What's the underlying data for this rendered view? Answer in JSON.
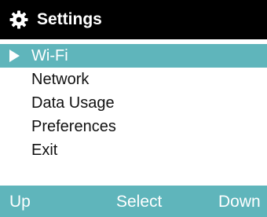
{
  "header": {
    "title": "Settings",
    "icon": "gear-icon"
  },
  "menu": {
    "selected_index": 0,
    "items": [
      {
        "label": "Wi-Fi"
      },
      {
        "label": "Network"
      },
      {
        "label": "Data Usage"
      },
      {
        "label": "Preferences"
      },
      {
        "label": "Exit"
      }
    ]
  },
  "softkeys": {
    "left": "Up",
    "center": "Select",
    "right": "Down"
  },
  "colors": {
    "header_bg": "#000000",
    "accent": "#5fb5bb",
    "text": "#111111"
  }
}
